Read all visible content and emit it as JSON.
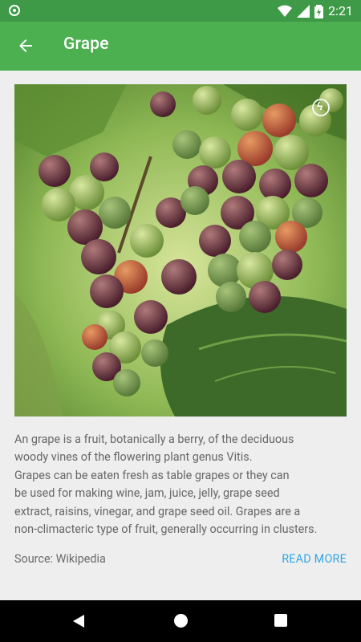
{
  "status_bar": {
    "time": "2:21",
    "icons": [
      "app-dot-icon",
      "wifi-icon",
      "signal-icon",
      "battery-icon"
    ]
  },
  "app_bar": {
    "title": "Grape",
    "color": "#4caf50"
  },
  "content": {
    "image_alt": "Grape cluster",
    "description": "An grape is a fruit, botanically a berry, of the deciduous\nwoody vines of the flowering plant genus Vitis.\nGrapes can be eaten fresh as table grapes or they can\nbe used for making wine, jam, juice, jelly, grape seed\nextract, raisins, vinegar, and grape seed oil. Grapes are a\nnon-climacteric type of fruit, generally occurring in clusters.",
    "source": "Source: Wikipedia",
    "read_more": "READ MORE"
  },
  "nav_bar": {
    "back": "back-icon",
    "home": "home-icon",
    "recents": "recents-icon"
  }
}
